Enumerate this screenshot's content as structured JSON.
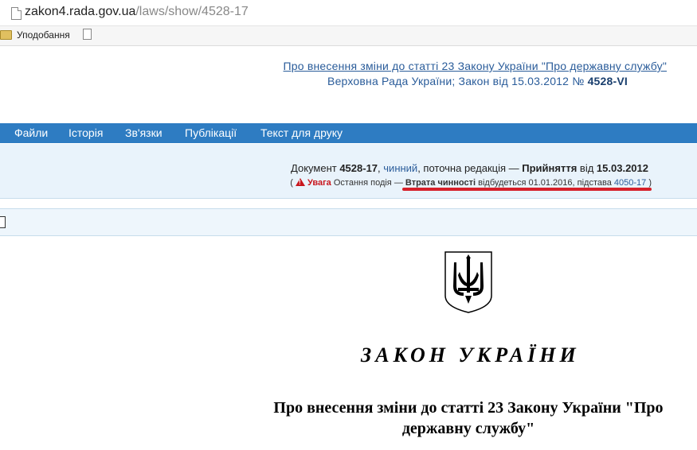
{
  "browser": {
    "url_host": "zakon4.rada.gov.ua",
    "url_path": "/laws/show/4528-17",
    "bookmarks_label": "Уподобання"
  },
  "header": {
    "title": "Про внесення зміни до статті 23 Закону України \"Про державну службу\"",
    "subtitle_prefix": "Верховна Рада України; Закон від 15.03.2012 №",
    "subtitle_number": "4528-VI"
  },
  "menu": [
    "Файли",
    "Історія",
    "Зв'язки",
    "Публікації",
    "Текст для друку"
  ],
  "info": {
    "doc_label": "Документ",
    "doc_number": "4528-17",
    "status": "чинний",
    "edition": ", поточна редакція —",
    "adoption_label": "Прийняття",
    "adoption_from": "від",
    "adoption_date": "15.03.2012",
    "open_paren": "(",
    "warning_label": "Увага",
    "last_event": "Остання подія —",
    "event_name": "Втрата чинності",
    "event_text": "відбудеться 01.01.2016, підстава",
    "basis_link": "4050-17",
    "close_paren": ")"
  },
  "document": {
    "law_title": "ЗАКОН УКРАЇНИ",
    "subtitle_line1": "Про внесення зміни до статті 23 Закону України \"Про",
    "subtitle_line2": "державну службу\""
  },
  "colors": {
    "menu_bg": "#2e7cc2",
    "link": "#2a5c9a",
    "warning": "#c8161d",
    "info_bg": "#e9f3fb"
  }
}
